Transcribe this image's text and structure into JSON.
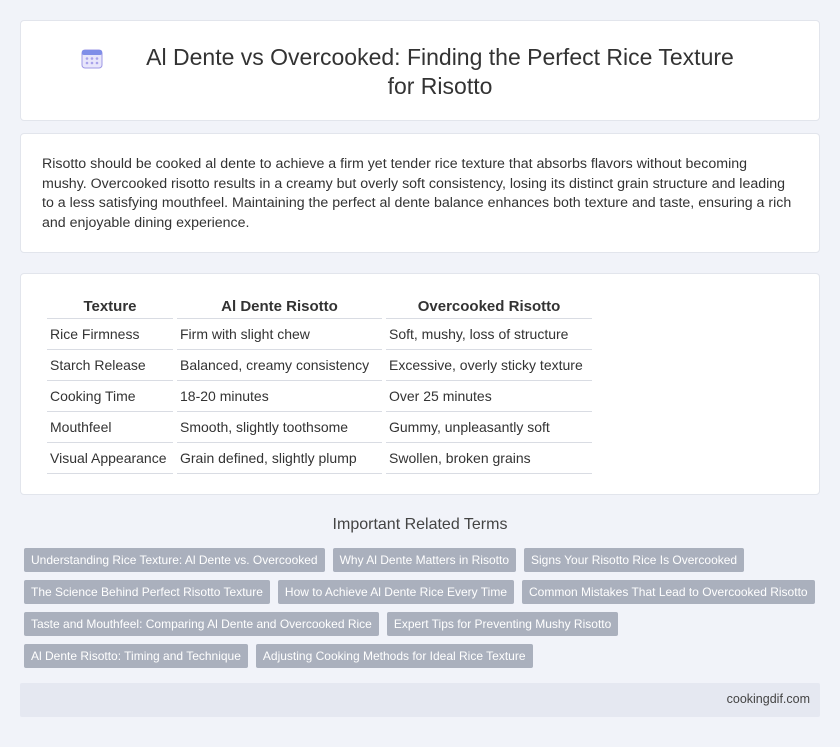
{
  "header": {
    "title": "Al Dente vs Overcooked: Finding the Perfect Rice Texture for Risotto",
    "icon": "calendar-icon"
  },
  "intro": {
    "text": "Risotto should be cooked al dente to achieve a firm yet tender rice texture that absorbs flavors without becoming mushy. Overcooked risotto results in a creamy but overly soft consistency, losing its distinct grain structure and leading to a less satisfying mouthfeel. Maintaining the perfect al dente balance enhances both texture and taste, ensuring a rich and enjoyable dining experience."
  },
  "table": {
    "headers": [
      "Texture",
      "Al Dente Risotto",
      "Overcooked Risotto"
    ],
    "rows": [
      [
        "Rice Firmness",
        "Firm with slight chew",
        "Soft, mushy, loss of structure"
      ],
      [
        "Starch Release",
        "Balanced, creamy consistency",
        "Excessive, overly sticky texture"
      ],
      [
        "Cooking Time",
        "18-20 minutes",
        "Over 25 minutes"
      ],
      [
        "Mouthfeel",
        "Smooth, slightly toothsome",
        "Gummy, unpleasantly soft"
      ],
      [
        "Visual Appearance",
        "Grain defined, slightly plump",
        "Swollen, broken grains"
      ]
    ]
  },
  "related": {
    "title": "Important Related Terms",
    "rows": [
      [
        "Understanding Rice Texture: Al Dente vs. Overcooked",
        "Why Al Dente Matters in Risotto",
        "Signs Your Risotto Rice Is Overcooked"
      ],
      [
        "The Science Behind Perfect Risotto Texture",
        "How to Achieve Al Dente Rice Every Time",
        "Common Mistakes That Lead to Overcooked Risotto"
      ],
      [
        "Taste and Mouthfeel: Comparing Al Dente and Overcooked Rice",
        "Expert Tips for Preventing Mushy Risotto"
      ],
      [
        "Al Dente Risotto: Timing and Technique",
        "Adjusting Cooking Methods for Ideal Rice Texture"
      ]
    ]
  },
  "footer": {
    "site": "cookingdif.com"
  }
}
